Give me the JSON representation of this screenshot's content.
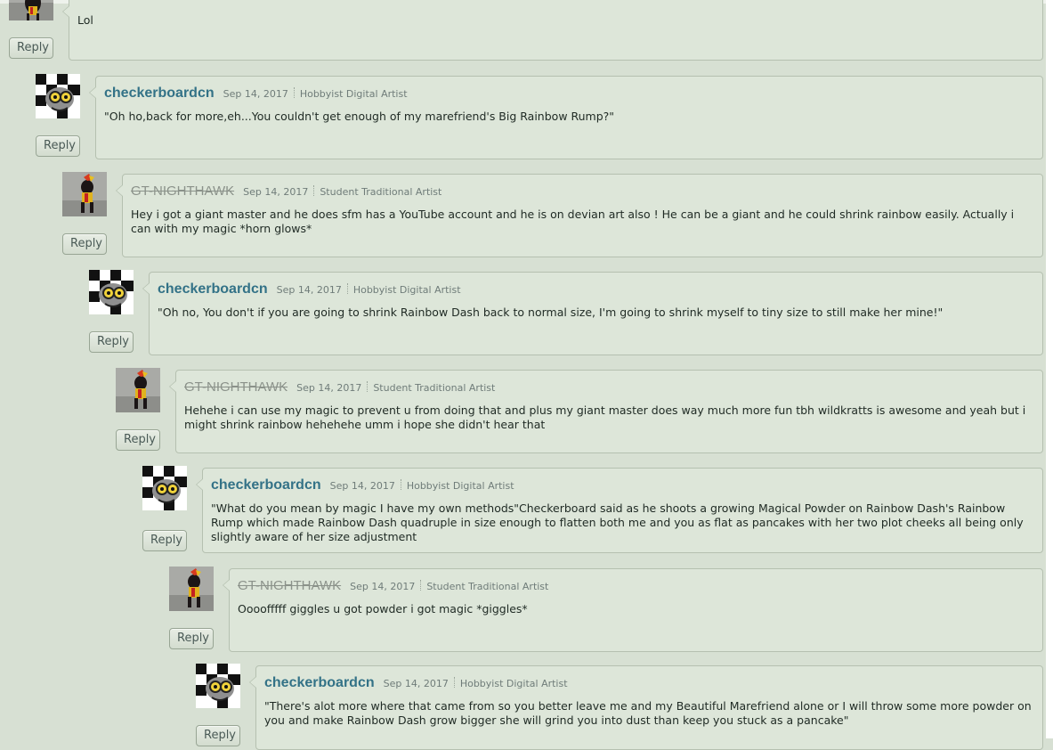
{
  "top_comment": {
    "text": "Lol",
    "reply_label": "Reply"
  },
  "comments": [
    {
      "username": "checkerboardcn",
      "date": "Sep 14, 2017",
      "role": "Hobbyist Digital Artist",
      "text": "\"Oh ho,back for more,eh...You couldn't get enough of my marefriend's Big Rainbow Rump?\"",
      "reply_label": "Reply"
    },
    {
      "username": "GT-NIGHTHAWK",
      "date": "Sep 14, 2017",
      "role": "Student Traditional Artist",
      "text": "Hey i got a giant master and he does sfm has a YouTube account and he is on devian art also ! He can be a giant and he could shrink rainbow easily. Actually i can with my magic *horn glows*",
      "reply_label": "Reply"
    },
    {
      "username": "checkerboardcn",
      "date": "Sep 14, 2017",
      "role": "Hobbyist Digital Artist",
      "text": "\"Oh no, You don't if you are going to shrink Rainbow Dash back to normal size, I'm going to shrink myself to tiny size to still make her mine!\"",
      "reply_label": "Reply"
    },
    {
      "username": "GT-NIGHTHAWK",
      "date": "Sep 14, 2017",
      "role": "Student Traditional Artist",
      "text": "Hehehe i can use my magic to prevent u from doing that and plus my giant master does way much more fun tbh wildkratts is awesome and yeah but i might shrink rainbow hehehehe umm i hope she didn't hear that",
      "reply_label": "Reply"
    },
    {
      "username": "checkerboardcn",
      "date": "Sep 14, 2017",
      "role": "Hobbyist Digital Artist",
      "text": "\"What do you mean by magic I have my own methods\"Checkerboard said as he shoots a growing Magical Powder on Rainbow Dash's Rainbow Rump which made Rainbow Dash quadruple in size enough to flatten both me and you as flat as pancakes with her two plot cheeks all being only slightly aware of her size adjustment",
      "reply_label": "Reply"
    },
    {
      "username": "GT-NIGHTHAWK",
      "date": "Sep 14, 2017",
      "role": "Student Traditional Artist",
      "text": "Oooofffff giggles u got powder i got magic *giggles*",
      "reply_label": "Reply"
    },
    {
      "username": "checkerboardcn",
      "date": "Sep 14, 2017",
      "role": "Hobbyist Digital Artist",
      "text": "\"There's alot more where that came from so you better leave me and my Beautiful Marefriend alone or I will throw some more powder on you and make Rainbow Dash grow bigger she will grind you into dust than keep you stuck as a pancake\"",
      "reply_label": "Reply"
    }
  ],
  "colors": {
    "background": "#d7e0d3",
    "bubble": "#dde6d9",
    "username": "#337287",
    "banned_username": "#8b928a"
  }
}
